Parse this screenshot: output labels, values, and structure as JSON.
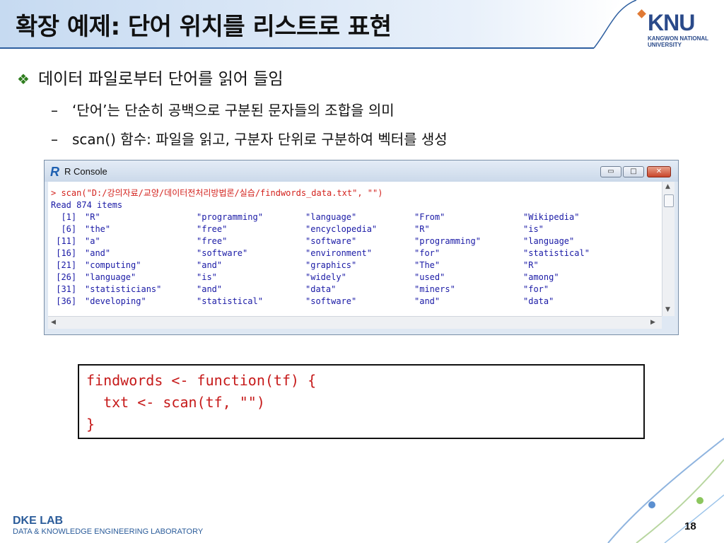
{
  "slide": {
    "title": "확장 예제: 단어 위치를 리스트로 표현",
    "logo": {
      "brand": "KNU",
      "subtitle": "KANGWON NATIONAL UNIVERSITY"
    },
    "bullet_main": "데이터 파일로부터 단어를 읽어 들임",
    "sub_bullets": [
      "‘단어’는 단순히 공백으로 구분된 문자들의 조합을 의미",
      "scan() 함수: 파일을 읽고, 구분자 단위로 구분하여 벡터를 생성"
    ],
    "footer_lab": "DKE LAB",
    "footer_lab_full": "DATA & KNOWLEDGE ENGINEERING LABORATORY",
    "page_number": "18"
  },
  "console": {
    "window_title": "R Console",
    "command": "> scan(\"D:/강의자료/교양/데이터전처리방법론/실습/findwords_data.txt\", \"\")",
    "read_line": "Read 874 items",
    "rows": [
      {
        "idx": "  [1]",
        "cells": [
          "\"R\"",
          "\"programming\"",
          "\"language\"",
          "\"From\"",
          "\"Wikipedia\""
        ]
      },
      {
        "idx": "  [6]",
        "cells": [
          "\"the\"",
          "\"free\"",
          "\"encyclopedia\"",
          "\"R\"",
          "\"is\""
        ]
      },
      {
        "idx": " [11]",
        "cells": [
          "\"a\"",
          "\"free\"",
          "\"software\"",
          "\"programming\"",
          "\"language\""
        ]
      },
      {
        "idx": " [16]",
        "cells": [
          "\"and\"",
          "\"software\"",
          "\"environment\"",
          "\"for\"",
          "\"statistical\""
        ]
      },
      {
        "idx": " [21]",
        "cells": [
          "\"computing\"",
          "\"and\"",
          "\"graphics\"",
          "\"The\"",
          "\"R\""
        ]
      },
      {
        "idx": " [26]",
        "cells": [
          "\"language\"",
          "\"is\"",
          "\"widely\"",
          "\"used\"",
          "\"among\""
        ]
      },
      {
        "idx": " [31]",
        "cells": [
          "\"statisticians\"",
          "\"and\"",
          "\"data\"",
          "\"miners\"",
          "\"for\""
        ]
      },
      {
        "idx": " [36]",
        "cells": [
          "\"developing\"",
          "\"statistical\"",
          "\"software\"",
          "\"and\"",
          "\"data\""
        ]
      }
    ]
  },
  "code": {
    "lines": [
      "findwords <- function(tf) {",
      "  txt <- scan(tf, \"\")",
      "}"
    ]
  },
  "colors": {
    "title_bg_left": "#c9dcf2",
    "accent_blue": "#2b5c9a",
    "code_red": "#c61a1a",
    "console_blue": "#1a1aa6",
    "console_red": "#d3221d",
    "bullet_green": "#2e7d1e"
  }
}
